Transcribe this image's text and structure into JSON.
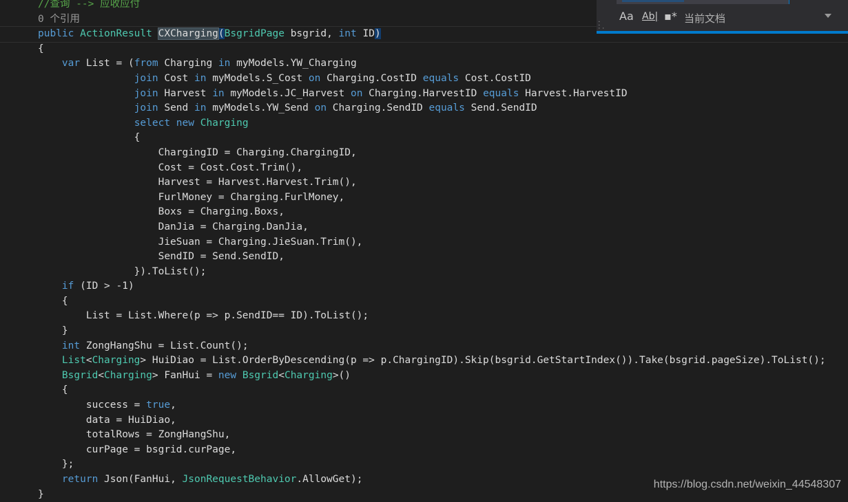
{
  "editor": {
    "lines": [
      [
        [
          "c",
          "//查询 --> 应收应付"
        ]
      ],
      [
        [
          "l",
          "0 个引用"
        ]
      ],
      [
        [
          "k",
          "public "
        ],
        [
          "t",
          "ActionResult "
        ],
        [
          "hl",
          "CXCharging"
        ],
        [
          "br",
          "("
        ],
        [
          "t",
          "BsgridPage"
        ],
        [
          "p",
          " bsgrid, "
        ],
        [
          "k",
          "int"
        ],
        [
          "p",
          " ID"
        ],
        [
          "br",
          ")"
        ]
      ],
      [
        [
          "p",
          "{"
        ]
      ],
      [
        [
          "p",
          "    "
        ],
        [
          "k",
          "var"
        ],
        [
          "p",
          " List = ("
        ],
        [
          "k",
          "from"
        ],
        [
          "p",
          " Charging "
        ],
        [
          "k",
          "in"
        ],
        [
          "p",
          " myModels.YW_Charging"
        ]
      ],
      [
        [
          "p",
          "                "
        ],
        [
          "k",
          "join"
        ],
        [
          "p",
          " Cost "
        ],
        [
          "k",
          "in"
        ],
        [
          "p",
          " myModels.S_Cost "
        ],
        [
          "k",
          "on"
        ],
        [
          "p",
          " Charging.CostID "
        ],
        [
          "k",
          "equals"
        ],
        [
          "p",
          " Cost.CostID"
        ]
      ],
      [
        [
          "p",
          "                "
        ],
        [
          "k",
          "join"
        ],
        [
          "p",
          " Harvest "
        ],
        [
          "k",
          "in"
        ],
        [
          "p",
          " myModels.JC_Harvest "
        ],
        [
          "k",
          "on"
        ],
        [
          "p",
          " Charging.HarvestID "
        ],
        [
          "k",
          "equals"
        ],
        [
          "p",
          " Harvest.HarvestID"
        ]
      ],
      [
        [
          "p",
          "                "
        ],
        [
          "k",
          "join"
        ],
        [
          "p",
          " Send "
        ],
        [
          "k",
          "in"
        ],
        [
          "p",
          " myModels.YW_Send "
        ],
        [
          "k",
          "on"
        ],
        [
          "p",
          " Charging.SendID "
        ],
        [
          "k",
          "equals"
        ],
        [
          "p",
          " Send.SendID"
        ]
      ],
      [
        [
          "p",
          "                "
        ],
        [
          "k",
          "select new "
        ],
        [
          "t",
          "Charging"
        ]
      ],
      [
        [
          "p",
          "                {"
        ]
      ],
      [
        [
          "p",
          "                    ChargingID = Charging.ChargingID,"
        ]
      ],
      [
        [
          "p",
          "                    Cost = Cost.Cost.Trim(),"
        ]
      ],
      [
        [
          "p",
          "                    Harvest = Harvest.Harvest.Trim(),"
        ]
      ],
      [
        [
          "p",
          "                    FurlMoney = Charging.FurlMoney,"
        ]
      ],
      [
        [
          "p",
          "                    Boxs = Charging.Boxs,"
        ]
      ],
      [
        [
          "p",
          "                    DanJia = Charging.DanJia,"
        ]
      ],
      [
        [
          "p",
          "                    JieSuan = Charging.JieSuan.Trim(),"
        ]
      ],
      [
        [
          "p",
          "                    SendID = Send.SendID,"
        ]
      ],
      [
        [
          "p",
          "                }).ToList();"
        ]
      ],
      [
        [
          "p",
          "    "
        ],
        [
          "k",
          "if"
        ],
        [
          "p",
          " (ID > -1)"
        ]
      ],
      [
        [
          "p",
          "    {"
        ]
      ],
      [
        [
          "p",
          "        List = List.Where(p => p.SendID== ID).ToList();"
        ]
      ],
      [
        [
          "p",
          "    }"
        ]
      ],
      [
        [
          "p",
          "    "
        ],
        [
          "k",
          "int"
        ],
        [
          "p",
          " ZongHangShu = List.Count();"
        ]
      ],
      [
        [
          "p",
          "    "
        ],
        [
          "t",
          "List"
        ],
        [
          "p",
          "<"
        ],
        [
          "t",
          "Charging"
        ],
        [
          "p",
          "> HuiDiao = List.OrderByDescending(p => p.ChargingID).Skip(bsgrid.GetStartIndex()).Take(bsgrid.pageSize).ToList();"
        ]
      ],
      [
        [
          "p",
          "    "
        ],
        [
          "t",
          "Bsgrid"
        ],
        [
          "p",
          "<"
        ],
        [
          "t",
          "Charging"
        ],
        [
          "p",
          "> FanHui = "
        ],
        [
          "k",
          "new "
        ],
        [
          "t",
          "Bsgrid"
        ],
        [
          "p",
          "<"
        ],
        [
          "t",
          "Charging"
        ],
        [
          "p",
          ">()"
        ]
      ],
      [
        [
          "p",
          "    {"
        ]
      ],
      [
        [
          "p",
          "        success = "
        ],
        [
          "k",
          "true"
        ],
        [
          "p",
          ","
        ]
      ],
      [
        [
          "p",
          "        data = HuiDiao,"
        ]
      ],
      [
        [
          "p",
          "        totalRows = ZongHangShu,"
        ]
      ],
      [
        [
          "p",
          "        curPage = bsgrid.curPage,"
        ]
      ],
      [
        [
          "p",
          "    };"
        ]
      ],
      [
        [
          "p",
          "    "
        ],
        [
          "k",
          "return"
        ],
        [
          "p",
          " Json(FanHui, "
        ],
        [
          "t",
          "JsonRequestBehavior"
        ],
        [
          "p",
          ".AllowGet);"
        ]
      ],
      [
        [
          "p",
          "}"
        ]
      ]
    ]
  },
  "find_widget": {
    "match_case_label": "Aa",
    "whole_word_label": "Ab|",
    "regex_label": "▪*",
    "scope": "当前文档"
  },
  "watermark": "https://blog.csdn.net/weixin_44548307",
  "colors": {
    "keyword": "#569cd6",
    "type": "#4ec9b0",
    "comment": "#57a64a",
    "accent": "#007acc",
    "background": "#1e1e1e"
  }
}
